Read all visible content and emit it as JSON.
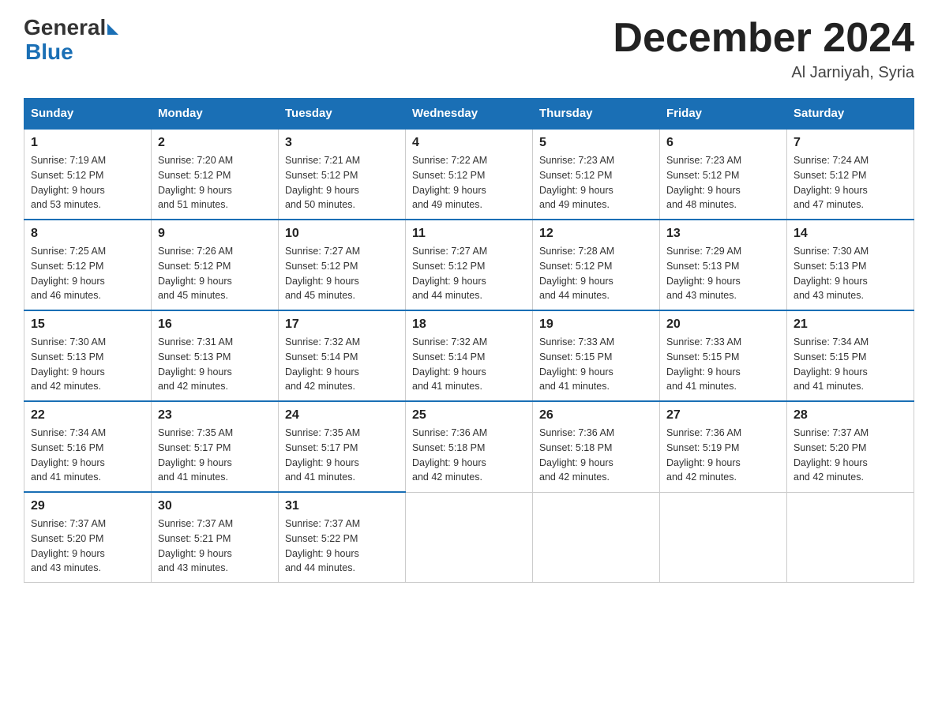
{
  "header": {
    "logo_general": "General",
    "logo_blue": "Blue",
    "month_title": "December 2024",
    "location": "Al Jarniyah, Syria"
  },
  "weekdays": [
    "Sunday",
    "Monday",
    "Tuesday",
    "Wednesday",
    "Thursday",
    "Friday",
    "Saturday"
  ],
  "weeks": [
    [
      {
        "day": "1",
        "sunrise": "7:19 AM",
        "sunset": "5:12 PM",
        "daylight": "9 hours and 53 minutes."
      },
      {
        "day": "2",
        "sunrise": "7:20 AM",
        "sunset": "5:12 PM",
        "daylight": "9 hours and 51 minutes."
      },
      {
        "day": "3",
        "sunrise": "7:21 AM",
        "sunset": "5:12 PM",
        "daylight": "9 hours and 50 minutes."
      },
      {
        "day": "4",
        "sunrise": "7:22 AM",
        "sunset": "5:12 PM",
        "daylight": "9 hours and 49 minutes."
      },
      {
        "day": "5",
        "sunrise": "7:23 AM",
        "sunset": "5:12 PM",
        "daylight": "9 hours and 49 minutes."
      },
      {
        "day": "6",
        "sunrise": "7:23 AM",
        "sunset": "5:12 PM",
        "daylight": "9 hours and 48 minutes."
      },
      {
        "day": "7",
        "sunrise": "7:24 AM",
        "sunset": "5:12 PM",
        "daylight": "9 hours and 47 minutes."
      }
    ],
    [
      {
        "day": "8",
        "sunrise": "7:25 AM",
        "sunset": "5:12 PM",
        "daylight": "9 hours and 46 minutes."
      },
      {
        "day": "9",
        "sunrise": "7:26 AM",
        "sunset": "5:12 PM",
        "daylight": "9 hours and 45 minutes."
      },
      {
        "day": "10",
        "sunrise": "7:27 AM",
        "sunset": "5:12 PM",
        "daylight": "9 hours and 45 minutes."
      },
      {
        "day": "11",
        "sunrise": "7:27 AM",
        "sunset": "5:12 PM",
        "daylight": "9 hours and 44 minutes."
      },
      {
        "day": "12",
        "sunrise": "7:28 AM",
        "sunset": "5:12 PM",
        "daylight": "9 hours and 44 minutes."
      },
      {
        "day": "13",
        "sunrise": "7:29 AM",
        "sunset": "5:13 PM",
        "daylight": "9 hours and 43 minutes."
      },
      {
        "day": "14",
        "sunrise": "7:30 AM",
        "sunset": "5:13 PM",
        "daylight": "9 hours and 43 minutes."
      }
    ],
    [
      {
        "day": "15",
        "sunrise": "7:30 AM",
        "sunset": "5:13 PM",
        "daylight": "9 hours and 42 minutes."
      },
      {
        "day": "16",
        "sunrise": "7:31 AM",
        "sunset": "5:13 PM",
        "daylight": "9 hours and 42 minutes."
      },
      {
        "day": "17",
        "sunrise": "7:32 AM",
        "sunset": "5:14 PM",
        "daylight": "9 hours and 42 minutes."
      },
      {
        "day": "18",
        "sunrise": "7:32 AM",
        "sunset": "5:14 PM",
        "daylight": "9 hours and 41 minutes."
      },
      {
        "day": "19",
        "sunrise": "7:33 AM",
        "sunset": "5:15 PM",
        "daylight": "9 hours and 41 minutes."
      },
      {
        "day": "20",
        "sunrise": "7:33 AM",
        "sunset": "5:15 PM",
        "daylight": "9 hours and 41 minutes."
      },
      {
        "day": "21",
        "sunrise": "7:34 AM",
        "sunset": "5:15 PM",
        "daylight": "9 hours and 41 minutes."
      }
    ],
    [
      {
        "day": "22",
        "sunrise": "7:34 AM",
        "sunset": "5:16 PM",
        "daylight": "9 hours and 41 minutes."
      },
      {
        "day": "23",
        "sunrise": "7:35 AM",
        "sunset": "5:17 PM",
        "daylight": "9 hours and 41 minutes."
      },
      {
        "day": "24",
        "sunrise": "7:35 AM",
        "sunset": "5:17 PM",
        "daylight": "9 hours and 41 minutes."
      },
      {
        "day": "25",
        "sunrise": "7:36 AM",
        "sunset": "5:18 PM",
        "daylight": "9 hours and 42 minutes."
      },
      {
        "day": "26",
        "sunrise": "7:36 AM",
        "sunset": "5:18 PM",
        "daylight": "9 hours and 42 minutes."
      },
      {
        "day": "27",
        "sunrise": "7:36 AM",
        "sunset": "5:19 PM",
        "daylight": "9 hours and 42 minutes."
      },
      {
        "day": "28",
        "sunrise": "7:37 AM",
        "sunset": "5:20 PM",
        "daylight": "9 hours and 42 minutes."
      }
    ],
    [
      {
        "day": "29",
        "sunrise": "7:37 AM",
        "sunset": "5:20 PM",
        "daylight": "9 hours and 43 minutes."
      },
      {
        "day": "30",
        "sunrise": "7:37 AM",
        "sunset": "5:21 PM",
        "daylight": "9 hours and 43 minutes."
      },
      {
        "day": "31",
        "sunrise": "7:37 AM",
        "sunset": "5:22 PM",
        "daylight": "9 hours and 44 minutes."
      },
      null,
      null,
      null,
      null
    ]
  ],
  "labels": {
    "sunrise": "Sunrise:",
    "sunset": "Sunset:",
    "daylight": "Daylight:"
  }
}
